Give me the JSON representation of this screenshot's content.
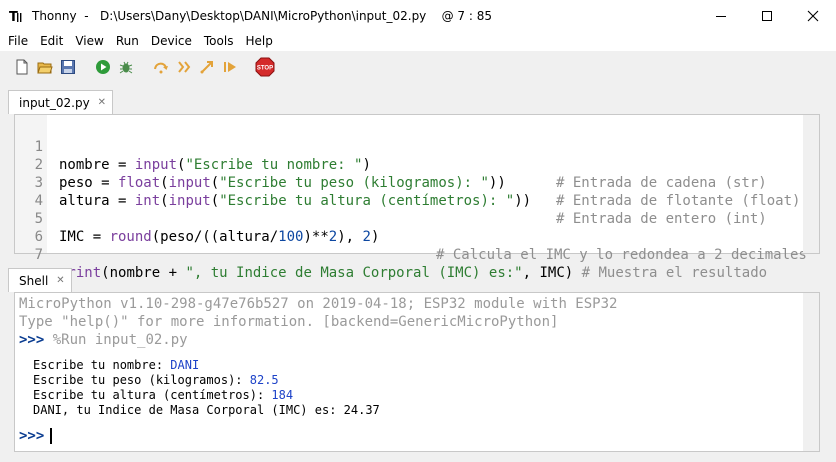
{
  "window": {
    "app_name": "Thonny",
    "file_path": "D:\\Users\\Dany\\Desktop\\DANI\\MicroPython\\input_02.py",
    "cursor_pos": "@  7 : 85"
  },
  "menu": [
    "File",
    "Edit",
    "View",
    "Run",
    "Device",
    "Tools",
    "Help"
  ],
  "toolbar": {
    "icons": [
      "new-file-icon",
      "open-folder-icon",
      "save-icon",
      "run-icon",
      "debug-icon",
      "step-over-icon",
      "step-into-icon",
      "step-out-icon",
      "resume-icon",
      "stop-icon"
    ],
    "stop_label": "STOP"
  },
  "editor": {
    "tab_label": "input_02.py",
    "line_numbers": [
      "1",
      "2",
      "3",
      "4",
      "5",
      "6",
      "7"
    ],
    "lines": [
      [
        "nombre = ",
        "input",
        "(",
        "\"Escribe tu nombre: \"",
        ")",
        "# Entrada de cadena (str)"
      ],
      [
        "peso = ",
        "float",
        "(",
        "input",
        "(",
        "\"Escribe tu peso (kilogramos): \"",
        "))",
        "# Entrada de flotante (float)"
      ],
      [
        "altura = ",
        "int",
        "(",
        "input",
        "(",
        "\"Escribe tu altura (centímetros): \"",
        "))",
        "# Entrada de entero (int)"
      ],
      [],
      [
        "IMC = ",
        "round",
        "(peso/((altura/",
        "100",
        ")**",
        "2",
        "), ",
        "2",
        ")",
        "# Calcula el IMC y lo redondea a 2 decimales"
      ],
      [],
      [
        "print",
        "(nombre + ",
        "\", tu Indice de Masa Corporal (IMC) es:\"",
        ", IMC) ",
        "# Muestra el resultado"
      ]
    ]
  },
  "shell": {
    "tab_label": "Shell",
    "banner_1": "MicroPython v1.10-298-g47e76b527 on 2019-04-18; ESP32 module with ESP32",
    "banner_2": "Type \"help()\" for more information. [backend=GenericMicroPython]",
    "prompt": ">>>",
    "run_cmd": "%Run input_02.py",
    "outputs": [
      {
        "label": "Escribe tu nombre: ",
        "value": "DANI"
      },
      {
        "label": "Escribe tu peso (kilogramos): ",
        "value": "82.5"
      },
      {
        "label": "Escribe tu altura (centímetros): ",
        "value": "184"
      }
    ],
    "result": "DANI, tu Indice de Masa Corporal (IMC) es: 24.37"
  }
}
